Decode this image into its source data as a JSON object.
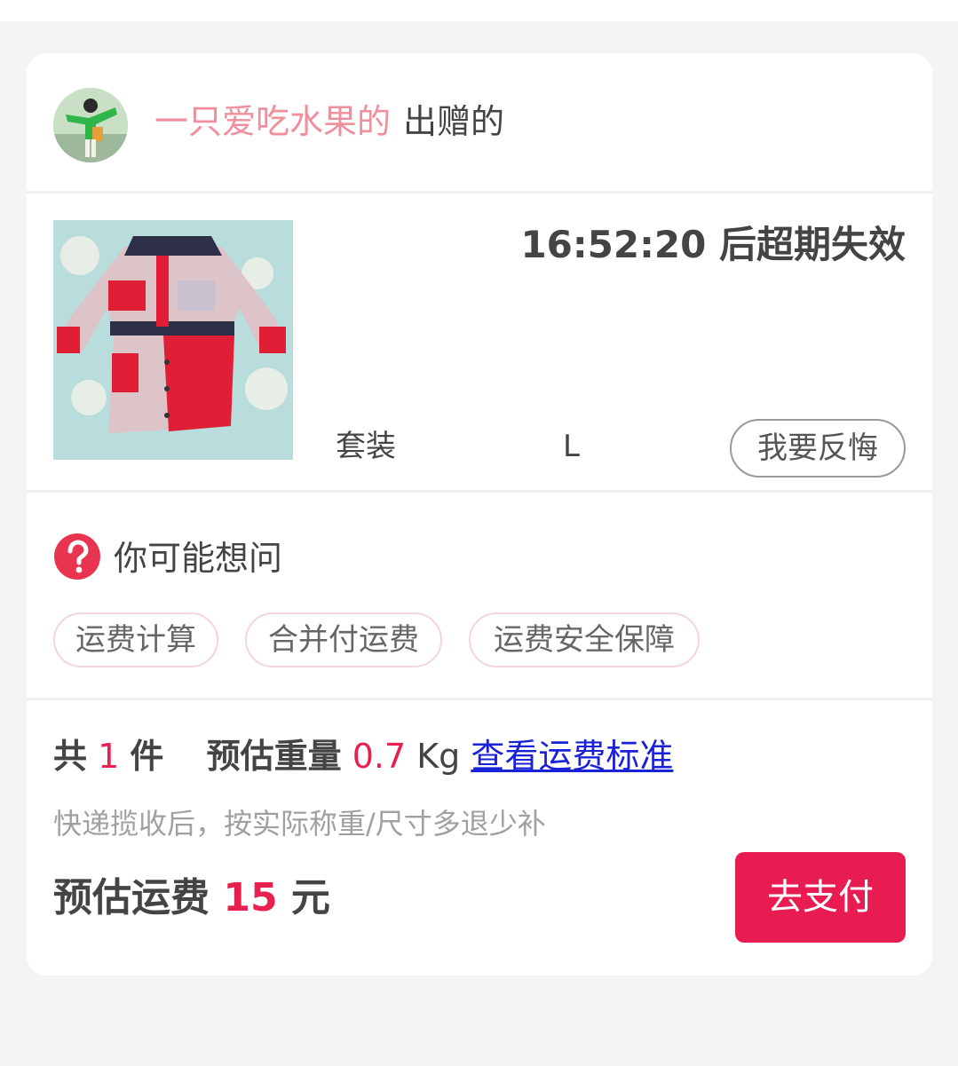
{
  "header": {
    "giver_name": "一只爱吃水果的",
    "gift_label": "出赠的"
  },
  "product": {
    "countdown": "16:52:20 后超期失效",
    "category": "套装",
    "size": "L",
    "regret_button": "我要反悔"
  },
  "faq": {
    "title": "你可能想问",
    "tags": [
      "运费计算",
      "合并付运费",
      "运费安全保障"
    ]
  },
  "summary": {
    "count_prefix": "共",
    "count": "1",
    "count_suffix": "件",
    "weight_label": "预估重量",
    "weight": "0.7",
    "weight_unit": "Kg",
    "fee_standard_link": "查看运费标准",
    "note": "快递揽收后，按实际称重/尺寸多退少补",
    "fee_label": "预估运费",
    "fee": "15",
    "fee_unit": "元",
    "pay_button": "去支付"
  },
  "colors": {
    "accent": "#e91c51",
    "giver_name": "#ef8f9c",
    "link": "#1a22d8",
    "tag_border": "#f3d5da"
  },
  "icons": [
    "avatar-image",
    "product-image",
    "question-icon"
  ]
}
